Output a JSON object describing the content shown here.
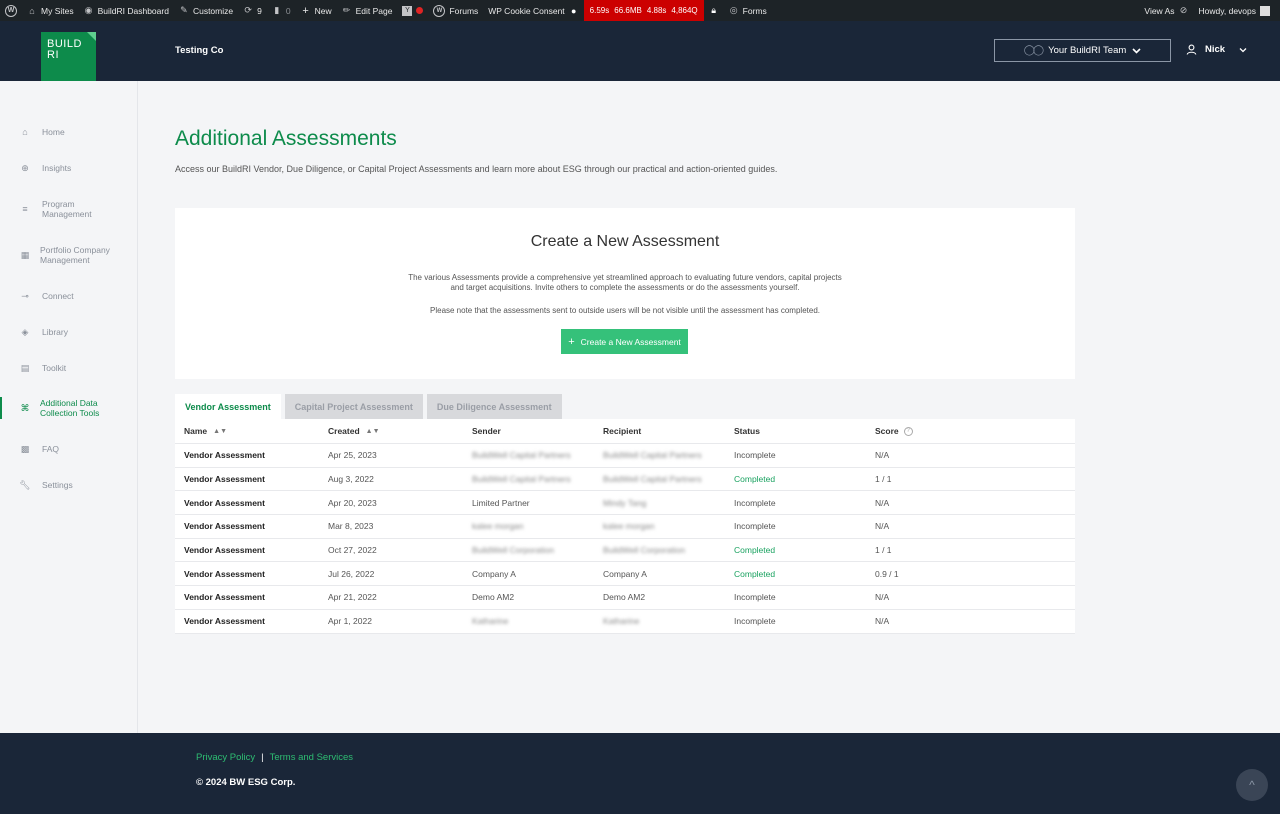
{
  "adminbar": {
    "wp_logo": "W",
    "my_sites": "My Sites",
    "dashboard": "BuildRI Dashboard",
    "customize": "Customize",
    "updates_count": "9",
    "comments_count": "0",
    "new": "New",
    "edit_page": "Edit Page",
    "forums": "Forums",
    "cookie_consent": "WP Cookie Consent",
    "perf": [
      "6.59s",
      "66.6MB",
      "4.88s",
      "4,864Q"
    ],
    "forms": "Forms",
    "view_as": "View As",
    "howdy": "Howdy, devops"
  },
  "header": {
    "logo_line1": "BUILD",
    "logo_line2": "RI",
    "company": "Testing Co",
    "team_select": "Your BuildRI Team",
    "user": "Nick"
  },
  "sidebar": {
    "items": [
      {
        "label": "Home",
        "icon": "home-icon"
      },
      {
        "label": "Insights",
        "icon": "globe-icon"
      },
      {
        "label": "Program Management",
        "icon": "program-icon"
      },
      {
        "label": "Portfolio Company Management",
        "icon": "portfolio-icon"
      },
      {
        "label": "Connect",
        "icon": "connect-icon"
      },
      {
        "label": "Library",
        "icon": "library-icon"
      },
      {
        "label": "Toolkit",
        "icon": "toolkit-icon"
      },
      {
        "label": "Additional Data Collection Tools",
        "icon": "command-icon"
      },
      {
        "label": "FAQ",
        "icon": "faq-icon"
      },
      {
        "label": "Settings",
        "icon": "wrench-icon"
      }
    ]
  },
  "main": {
    "title": "Additional Assessments",
    "description": "Access our BuildRI Vendor, Due Diligence, or Capital Project Assessments and learn more about ESG through our practical and action-oriented guides.",
    "card": {
      "title": "Create a New Assessment",
      "text1_line1": "The various Assessments provide a comprehensive yet streamlined approach to evaluating future vendors, capital projects",
      "text1_line2": "and target acquisitions. Invite others to complete the assessments or do the assessments yourself.",
      "text2": "Please note that the assessments sent to outside users will be not visible until the assessment has completed.",
      "button": "Create a New Assessment"
    },
    "tabs": [
      "Vendor Assessment",
      "Capital Project Assessment",
      "Due Diligence Assessment"
    ],
    "table": {
      "headers": [
        "Name",
        "Created",
        "Sender",
        "Recipient",
        "Status",
        "Score"
      ],
      "rows": [
        {
          "name": "Vendor Assessment",
          "created": "Apr 25, 2023",
          "sender": "BuildWell Capital Partners",
          "recipient": "BuildWell Capital Partners",
          "status": "Incomplete",
          "score": "N/A"
        },
        {
          "name": "Vendor Assessment",
          "created": "Aug 3, 2022",
          "sender": "BuildWell Capital Partners",
          "recipient": "BuildWell Capital Partners",
          "status": "Completed",
          "score": "1 / 1"
        },
        {
          "name": "Vendor Assessment",
          "created": "Apr 20, 2023",
          "sender": "Limited Partner",
          "recipient": "Mindy Tang",
          "status": "Incomplete",
          "score": "N/A"
        },
        {
          "name": "Vendor Assessment",
          "created": "Mar 8, 2023",
          "sender": "kalee morgan",
          "recipient": "kalee morgan",
          "status": "Incomplete",
          "score": "N/A"
        },
        {
          "name": "Vendor Assessment",
          "created": "Oct 27, 2022",
          "sender": "BuildWell Corporation",
          "recipient": "BuildWell Corporation",
          "status": "Completed",
          "score": "1 / 1"
        },
        {
          "name": "Vendor Assessment",
          "created": "Jul 26, 2022",
          "sender": "Company A",
          "recipient": "Company A",
          "status": "Completed",
          "score": "0.9 / 1"
        },
        {
          "name": "Vendor Assessment",
          "created": "Apr 21, 2022",
          "sender": "Demo AM2",
          "recipient": "Demo AM2",
          "status": "Incomplete",
          "score": "N/A"
        },
        {
          "name": "Vendor Assessment",
          "created": "Apr 1, 2022",
          "sender": "Katharine",
          "recipient": "Katharine",
          "status": "Incomplete",
          "score": "N/A"
        }
      ]
    }
  },
  "footer": {
    "privacy": "Privacy Policy",
    "separator": "|",
    "terms": "Terms and Services",
    "copyright": "© 2024 BW ESG Corp.",
    "to_top": "^"
  },
  "colors": {
    "brand_green": "#0d8b4b",
    "button_green": "#35c17a",
    "navy": "#1a2638"
  }
}
